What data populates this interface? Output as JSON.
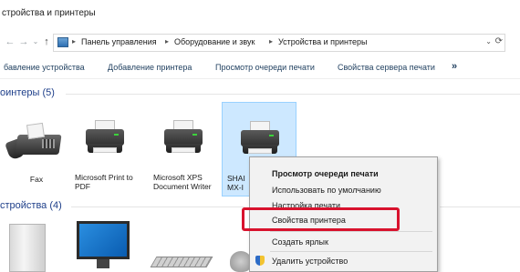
{
  "window": {
    "title": "стройства и принтеры"
  },
  "addressbar": {
    "crumbs": [
      "Панель управления",
      "Оборудование и звук",
      "Устройства и принтеры"
    ],
    "refresh_icon": "refresh-icon"
  },
  "commandbar": {
    "items": [
      "бавление устройства",
      "Добавление принтера",
      "Просмотр очереди печати",
      "Свойства сервера печати"
    ],
    "more": "»"
  },
  "groups": {
    "printers": {
      "header": "оинтеры (5)"
    },
    "devices": {
      "header": "стройства (4)"
    }
  },
  "printers": [
    {
      "label": "Fax",
      "icon": "fax-icon"
    },
    {
      "label": "Microsoft Print to PDF",
      "icon": "printer-icon"
    },
    {
      "label": "Microsoft XPS Document Writer",
      "icon": "printer-icon"
    },
    {
      "label": "SHAI MX-I",
      "icon": "printer-icon",
      "selected": true
    }
  ],
  "context_menu": {
    "items": [
      {
        "label": "Просмотр очереди печати",
        "bold": true
      },
      {
        "label": "Использовать по умолчанию"
      },
      {
        "label": "Настройка печати"
      },
      {
        "label": "Свойства принтера",
        "highlighted": true
      },
      {
        "label": "Создать ярлык"
      },
      {
        "label": "Удалить устройство",
        "icon": "shield-icon"
      }
    ],
    "highlight_color": "#d8122d"
  },
  "colors": {
    "selection": "#cde8ff",
    "group_header": "#1e3f8a",
    "accent_link": "#1e3e5e"
  }
}
